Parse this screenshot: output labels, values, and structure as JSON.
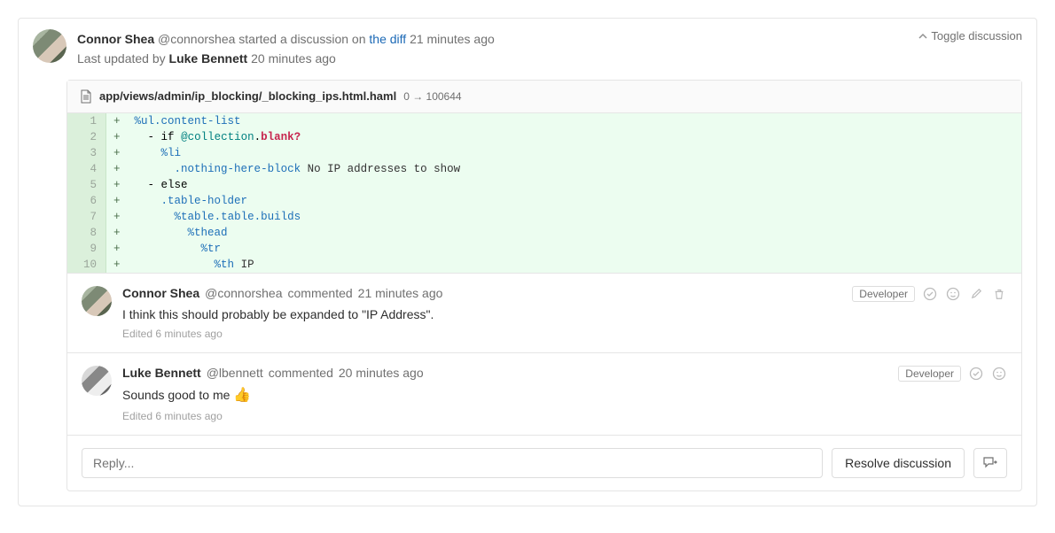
{
  "header": {
    "author": "Connor Shea",
    "username": "@connorshea",
    "started_text": "started a discussion on",
    "diff_link": "the diff",
    "time": "21 minutes ago",
    "updated_prefix": "Last updated by",
    "updated_by": "Luke Bennett",
    "updated_time": "20 minutes ago",
    "toggle": "Toggle discussion"
  },
  "file": {
    "path": "app/views/admin/ip_blocking/_blocking_ips.html.haml",
    "mode": "0 → 100644"
  },
  "diff": [
    {
      "n": "1",
      "p": "+",
      "html": "<span class='tok-tag'>%ul</span><span class='tok-class'>.content-list</span>"
    },
    {
      "n": "2",
      "p": "+",
      "html": "  <span class='tok-kw'>- if</span> <span class='tok-var'>@collection</span><span class='tok-kw'>.</span><span class='tok-attr'>blank?</span>"
    },
    {
      "n": "3",
      "p": "+",
      "html": "    <span class='tok-tag'>%li</span>"
    },
    {
      "n": "4",
      "p": "+",
      "html": "      <span class='tok-class'>.nothing-here-block</span> <span class='tok-text'>No IP addresses to show</span>"
    },
    {
      "n": "5",
      "p": "+",
      "html": "  <span class='tok-kw'>- else</span>"
    },
    {
      "n": "6",
      "p": "+",
      "html": "    <span class='tok-class'>.table-holder</span>"
    },
    {
      "n": "7",
      "p": "+",
      "html": "      <span class='tok-tag'>%table</span><span class='tok-class'>.table.builds</span>"
    },
    {
      "n": "8",
      "p": "+",
      "html": "        <span class='tok-tag'>%thead</span>"
    },
    {
      "n": "9",
      "p": "+",
      "html": "          <span class='tok-tag'>%tr</span>"
    },
    {
      "n": "10",
      "p": "+",
      "html": "            <span class='tok-tag'>%th</span> <span class='tok-text'>IP</span>"
    }
  ],
  "comments": [
    {
      "author": "Connor Shea",
      "username": "@connorshea",
      "action": "commented",
      "time": "21 minutes ago",
      "body_html": "I think this should probably be expanded to \"IP Address\".",
      "edited": "Edited 6 minutes ago",
      "badge": "Developer",
      "avatar": "av1",
      "show_edit_delete": true
    },
    {
      "author": "Luke Bennett",
      "username": "@lbennett",
      "action": "commented",
      "time": "20 minutes ago",
      "body_html": "Sounds good to me <span class='thumbs'>👍</span>",
      "edited": "Edited 6 minutes ago",
      "badge": "Developer",
      "avatar": "av2",
      "show_edit_delete": false
    }
  ],
  "reply": {
    "placeholder": "Reply...",
    "resolve": "Resolve discussion"
  }
}
